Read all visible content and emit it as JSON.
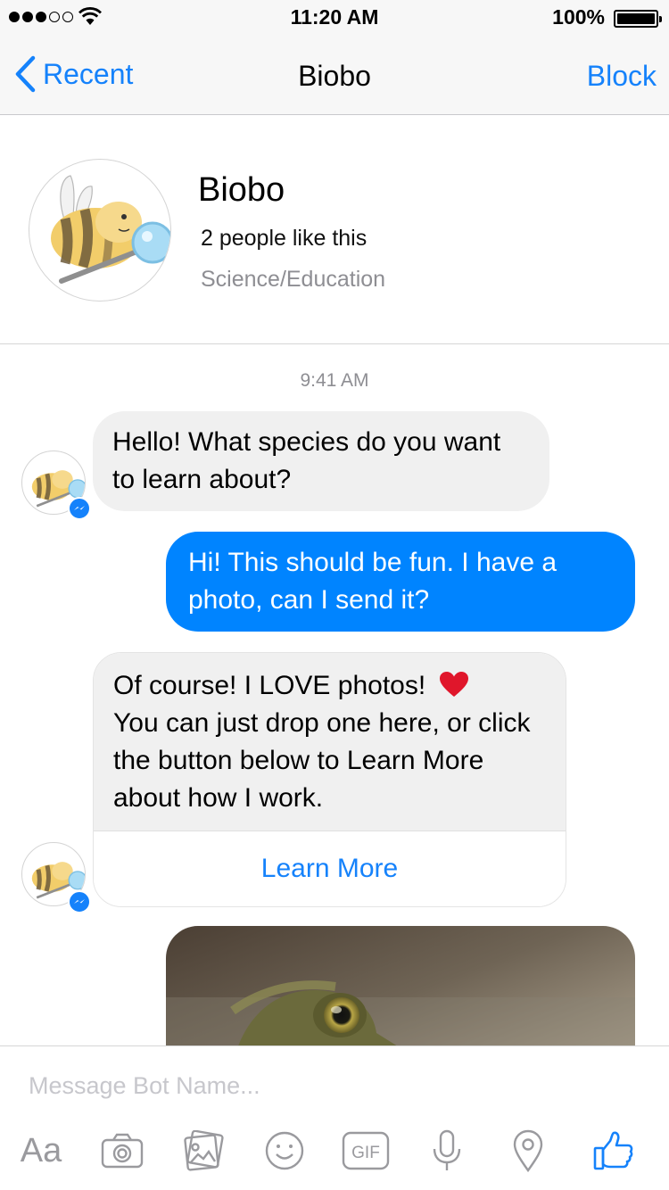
{
  "status_bar": {
    "time": "11:20 AM",
    "battery": "100%",
    "signal_bars_filled": 3,
    "signal_bars_total": 5
  },
  "nav": {
    "back_label": "Recent",
    "title": "Biobo",
    "action_label": "Block"
  },
  "profile": {
    "name": "Biobo",
    "likes": "2 people like this",
    "category": "Science/Education"
  },
  "thread": {
    "timestamp": "9:41 AM",
    "messages": [
      {
        "from": "bot",
        "text": "Hello! What species do you want to learn about?"
      },
      {
        "from": "user",
        "text": "Hi! This should be fun. I have a photo, can I send it?"
      },
      {
        "from": "bot",
        "text": "Of course! I LOVE photos!",
        "text2": "You can just drop one here, or click the button below to Learn More about how I work.",
        "button": "Learn More"
      },
      {
        "from": "user",
        "type": "photo"
      }
    ]
  },
  "composer": {
    "placeholder": "Message Bot Name...",
    "aa_label": "Aa",
    "icons": [
      "text-format-icon",
      "camera-icon",
      "gallery-icon",
      "emoji-icon",
      "gif-icon",
      "microphone-icon",
      "location-icon",
      "thumbs-up-icon"
    ]
  },
  "colors": {
    "accent": "#1582fb",
    "outgoing_bubble": "#0084ff",
    "incoming_bubble": "#f0f0f0",
    "secondary_text": "#8e8e93"
  }
}
